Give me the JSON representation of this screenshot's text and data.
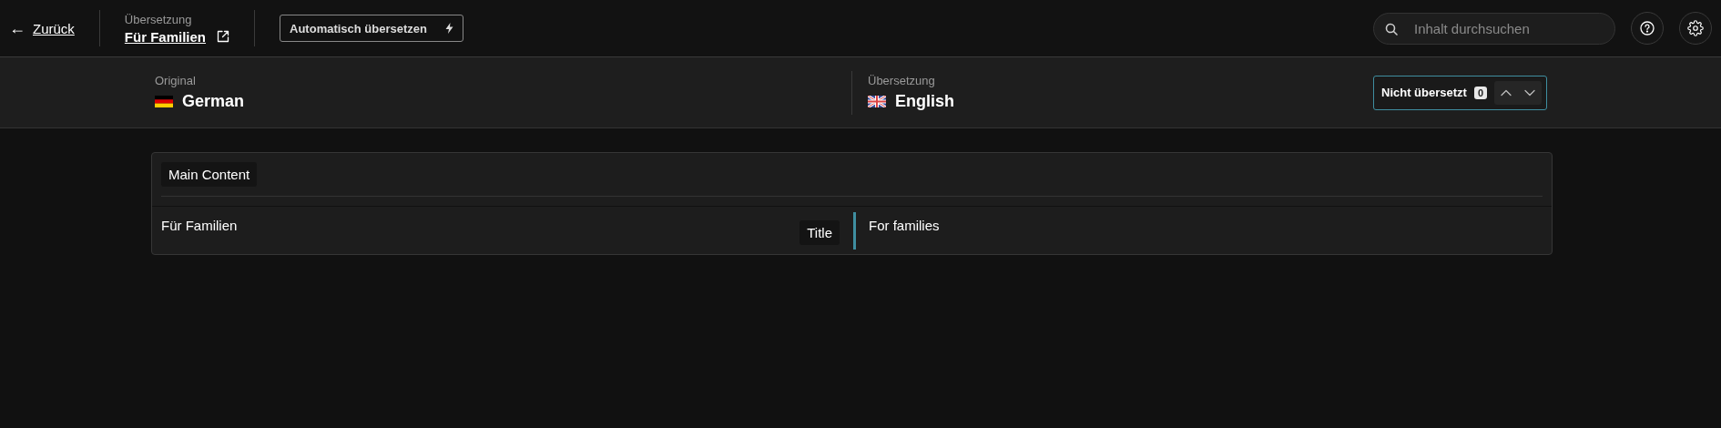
{
  "top_bar": {
    "back": {
      "icon": "←",
      "label": "Zurück"
    },
    "breadcrumb": {
      "label": "Übersetzung",
      "title": "Für Familien"
    },
    "auto_translate": {
      "label": "Automatisch übersetzen"
    },
    "search": {
      "placeholder": "Inhalt durchsuchen"
    }
  },
  "language_bar": {
    "source": {
      "label": "Original",
      "language": "German"
    },
    "target": {
      "label": "Übersetzung",
      "language": "English"
    },
    "filter": {
      "label": "Nicht übersetzt",
      "count": "0"
    }
  },
  "section": {
    "title": "Main Content",
    "rows": [
      {
        "source": "Für Familien",
        "field": "Title",
        "target": "For families"
      }
    ]
  }
}
